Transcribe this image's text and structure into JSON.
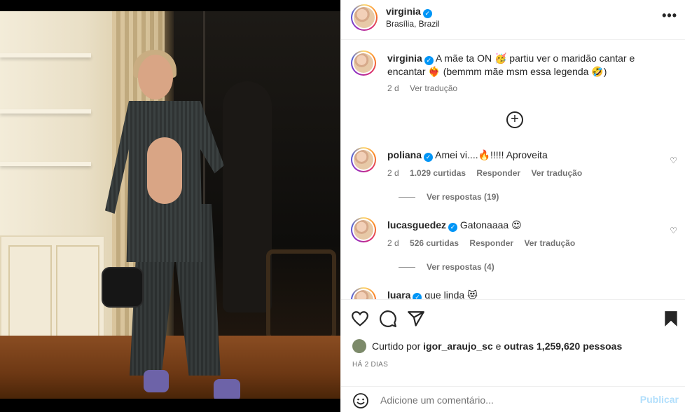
{
  "post": {
    "author": "virginia",
    "location": "Brasília, Brazil",
    "more_label": "•••"
  },
  "caption": {
    "username": "virginia",
    "text": "A mãe ta ON 🥳 partiu ver o maridão cantar e encantar ❤️‍🔥 (bemmm mãe msm essa legenda 🤣)",
    "time": "2 d",
    "translate": "Ver tradução"
  },
  "comments": [
    {
      "username": "poliana",
      "text": "Amei vi....🔥!!!!! Aproveita",
      "time": "2 d",
      "likes": "1.029 curtidas",
      "reply": "Responder",
      "translate": "Ver tradução",
      "replies": "Ver respostas (19)"
    },
    {
      "username": "lucasguedez",
      "text": "Gatonaaaa 😍",
      "time": "2 d",
      "likes": "526 curtidas",
      "reply": "Responder",
      "translate": "Ver tradução",
      "replies": "Ver respostas (4)"
    },
    {
      "username": "luara",
      "text": "que linda 😻"
    }
  ],
  "likes": {
    "prefix": "Curtido por",
    "user": "igor_araujo_sc",
    "middle": "e",
    "others": "outras 1,259,620 pessoas"
  },
  "timestamp": "HÁ 2 DIAS",
  "comment_box": {
    "placeholder": "Adicione um comentário...",
    "publish": "Publicar"
  },
  "colors": {
    "verified": "#0095f6",
    "publish_disabled": "#b2dffc",
    "meta_text": "#737373"
  }
}
